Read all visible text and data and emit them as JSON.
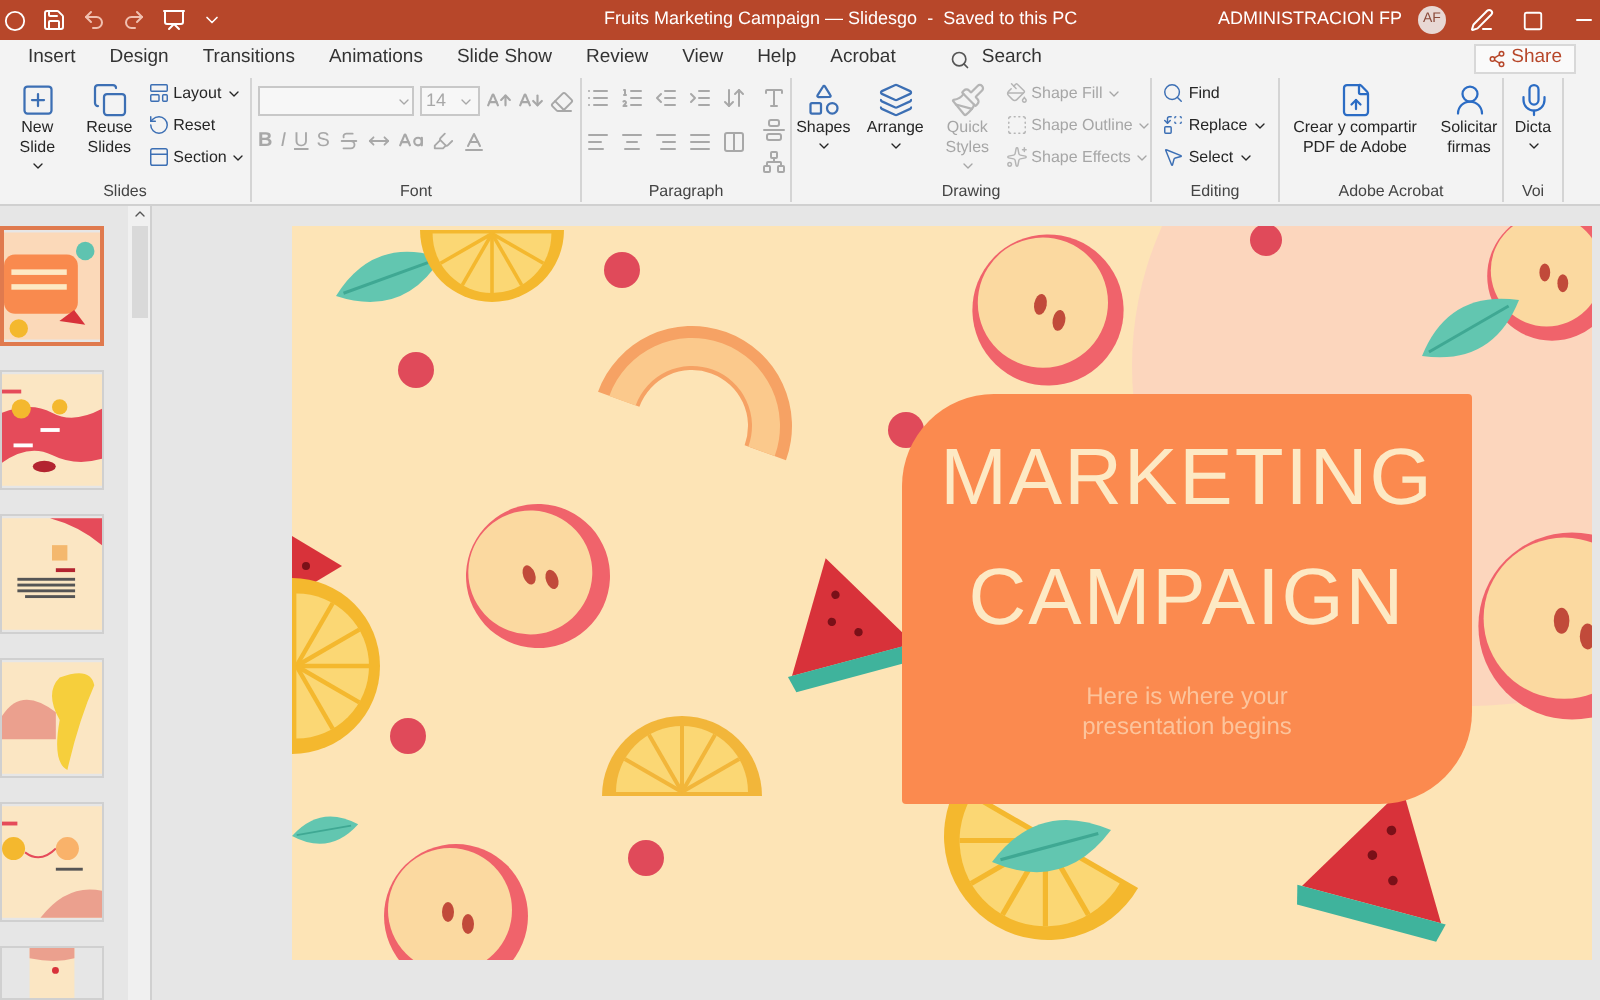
{
  "title_bar": {
    "title": "Fruits Marketing Campaign — Slidesgo  -  Saved to this PC",
    "user": "ADMINISTRACION FP",
    "initials": "AF"
  },
  "tabs": [
    {
      "label": "Insert",
      "selected": false
    },
    {
      "label": "Design",
      "selected": false
    },
    {
      "label": "Transitions",
      "selected": false
    },
    {
      "label": "Animations",
      "selected": false
    },
    {
      "label": "Slide Show",
      "selected": false
    },
    {
      "label": "Review",
      "selected": false
    },
    {
      "label": "View",
      "selected": false
    },
    {
      "label": "Help",
      "selected": false
    },
    {
      "label": "Acrobat",
      "selected": false
    }
  ],
  "search": {
    "placeholder": "Search"
  },
  "share": "Share",
  "ribbon": [
    {
      "kind": "slides",
      "label": "Slides",
      "items": [
        {
          "kind": "large",
          "label": "New Slide",
          "dropdown": true,
          "disabled": false
        },
        {
          "kind": "large",
          "label": "Reuse Slides",
          "dropdown": false,
          "disabled": false
        },
        {
          "kind": "small",
          "label": "Layout",
          "dropdown": true,
          "disabled": false
        },
        {
          "kind": "small",
          "label": "Reset",
          "dropdown": false,
          "disabled": false
        },
        {
          "kind": "small",
          "label": "Section",
          "dropdown": true,
          "disabled": false
        }
      ]
    },
    {
      "kind": "font",
      "label": "Font",
      "disabled": true,
      "font_size": "14",
      "format_buttons": [
        "B",
        "I",
        "U",
        "S"
      ]
    },
    {
      "kind": "paragraph",
      "label": "Paragraph",
      "disabled": true
    },
    {
      "kind": "drawing",
      "label": "Drawing",
      "items": [
        {
          "kind": "large",
          "label": "Shapes",
          "dropdown": true,
          "disabled": false
        },
        {
          "kind": "large",
          "label": "Arrange",
          "dropdown": true,
          "disabled": false
        },
        {
          "kind": "large",
          "label": "Quick Styles",
          "dropdown": true,
          "disabled": true
        },
        {
          "kind": "small",
          "label": "Shape Fill",
          "dropdown": true,
          "disabled": true
        },
        {
          "kind": "small",
          "label": "Shape Outline",
          "dropdown": true,
          "disabled": true
        },
        {
          "kind": "small",
          "label": "Shape Effects",
          "dropdown": true,
          "disabled": true
        }
      ]
    },
    {
      "kind": "editing",
      "label": "Editing",
      "items": [
        {
          "kind": "small",
          "label": "Find",
          "dropdown": false,
          "disabled": false
        },
        {
          "kind": "small",
          "label": "Replace",
          "dropdown": true,
          "disabled": false
        },
        {
          "kind": "small",
          "label": "Select",
          "dropdown": true,
          "disabled": false
        }
      ]
    },
    {
      "kind": "acrobat",
      "label": "Adobe Acrobat",
      "items": [
        {
          "kind": "large",
          "label": "Crear y compartir PDF de Adobe",
          "dropdown": false,
          "disabled": false
        },
        {
          "kind": "large",
          "label": "Solicitar firmas",
          "dropdown": false,
          "disabled": false
        }
      ]
    },
    {
      "kind": "voice",
      "label": "Voi",
      "items": [
        {
          "kind": "large",
          "label": "Dicta",
          "dropdown": true,
          "disabled": false
        }
      ]
    }
  ],
  "thumbnails": [
    {
      "selected": true
    },
    {
      "selected": false
    },
    {
      "selected": false
    },
    {
      "selected": false
    },
    {
      "selected": false
    },
    {
      "selected": false
    }
  ],
  "slide": {
    "title": "MARKETING CAMPAIGN",
    "subtitle": "Here is where your presentation begins"
  }
}
